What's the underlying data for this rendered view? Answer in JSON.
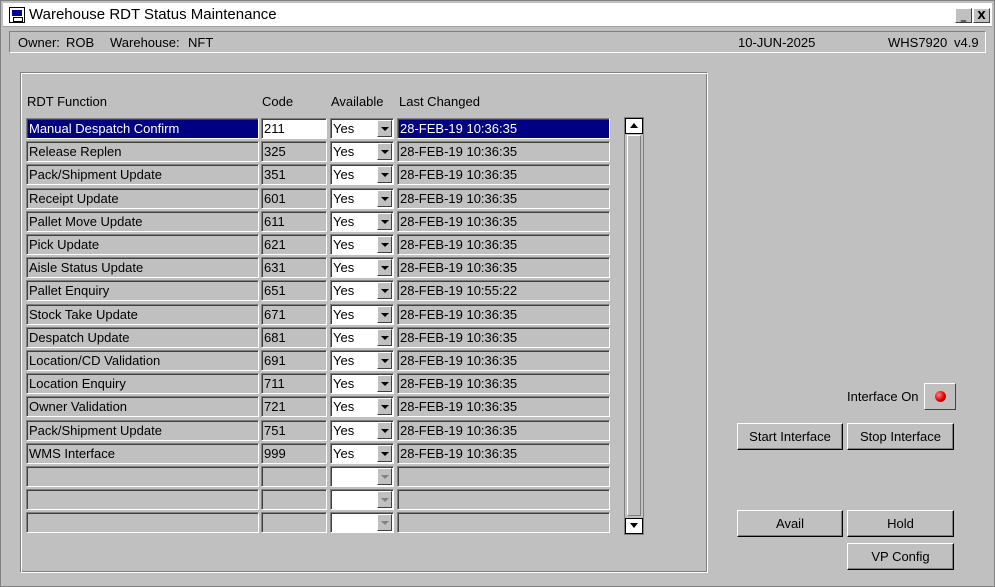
{
  "window": {
    "title": "Warehouse RDT Status Maintenance",
    "minimize_label": "_",
    "close_label": "X"
  },
  "info": {
    "owner_label": "Owner:",
    "owner_value": "ROB",
    "warehouse_label": "Warehouse:",
    "warehouse_value": "NFT",
    "date": "10-JUN-2025",
    "screen_code": "WHS7920",
    "version": "v4.9"
  },
  "columns": {
    "function": "RDT Function",
    "code": "Code",
    "available": "Available",
    "last_changed": "Last Changed"
  },
  "rows": [
    {
      "function": "Manual Despatch Confirm",
      "code": "211",
      "available": "Yes",
      "last_changed": "28-FEB-19 10:36:35"
    },
    {
      "function": "Release Replen",
      "code": "325",
      "available": "Yes",
      "last_changed": "28-FEB-19 10:36:35"
    },
    {
      "function": "Pack/Shipment Update",
      "code": "351",
      "available": "Yes",
      "last_changed": "28-FEB-19 10:36:35"
    },
    {
      "function": "Receipt Update",
      "code": "601",
      "available": "Yes",
      "last_changed": "28-FEB-19 10:36:35"
    },
    {
      "function": "Pallet Move Update",
      "code": "611",
      "available": "Yes",
      "last_changed": "28-FEB-19 10:36:35"
    },
    {
      "function": "Pick Update",
      "code": "621",
      "available": "Yes",
      "last_changed": "28-FEB-19 10:36:35"
    },
    {
      "function": "Aisle Status Update",
      "code": "631",
      "available": "Yes",
      "last_changed": "28-FEB-19 10:36:35"
    },
    {
      "function": "Pallet Enquiry",
      "code": "651",
      "available": "Yes",
      "last_changed": "28-FEB-19 10:55:22"
    },
    {
      "function": "Stock Take Update",
      "code": "671",
      "available": "Yes",
      "last_changed": "28-FEB-19 10:36:35"
    },
    {
      "function": "Despatch Update",
      "code": "681",
      "available": "Yes",
      "last_changed": "28-FEB-19 10:36:35"
    },
    {
      "function": "Location/CD Validation",
      "code": "691",
      "available": "Yes",
      "last_changed": "28-FEB-19 10:36:35"
    },
    {
      "function": "Location Enquiry",
      "code": "711",
      "available": "Yes",
      "last_changed": "28-FEB-19 10:36:35"
    },
    {
      "function": "Owner Validation",
      "code": "721",
      "available": "Yes",
      "last_changed": "28-FEB-19 10:36:35"
    },
    {
      "function": "Pack/Shipment Update",
      "code": "751",
      "available": "Yes",
      "last_changed": "28-FEB-19 10:36:35"
    },
    {
      "function": "WMS Interface",
      "code": "999",
      "available": "Yes",
      "last_changed": "28-FEB-19 10:36:35"
    }
  ],
  "empty_rows": 3,
  "selected_row": 0,
  "interface": {
    "label": "Interface On",
    "status_color": "#e00000"
  },
  "buttons": {
    "start_interface": "Start Interface",
    "stop_interface": "Stop Interface",
    "avail": "Avail",
    "hold": "Hold",
    "vp_config": "VP Config"
  },
  "colors": {
    "selection": "#000080",
    "background": "#c0c0c0"
  }
}
